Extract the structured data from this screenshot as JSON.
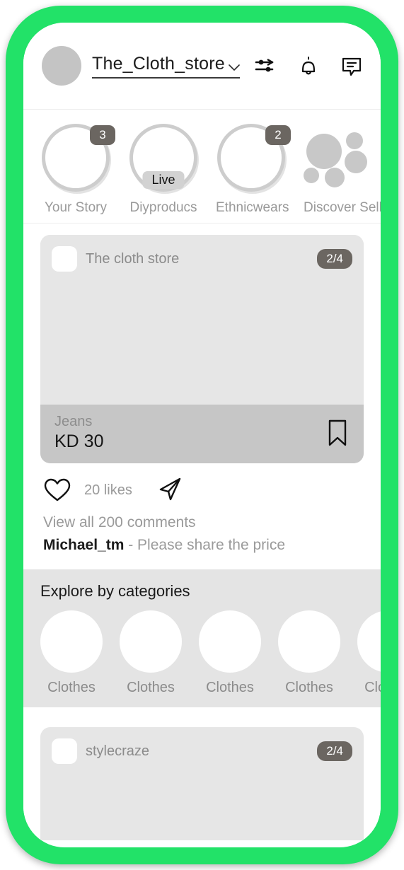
{
  "theme": {
    "frame_color": "#22e268",
    "screen_background": "#ffffff",
    "badge_color": "#6b6661"
  },
  "header": {
    "avatar": "profile-avatar",
    "store_name": "The_Cloth_store",
    "dropdown_icon": "chevron-down-icon",
    "icons": [
      {
        "name": "filter-sliders-icon",
        "label": "Filters"
      },
      {
        "name": "bell-icon",
        "label": "Notifications"
      },
      {
        "name": "message-icon",
        "label": "Messages"
      }
    ]
  },
  "stories": [
    {
      "label": "Your Story",
      "badge": "3",
      "live": false,
      "type": "ring"
    },
    {
      "label": "Diyproducs",
      "badge": "",
      "live": true,
      "live_label": "Live",
      "type": "ring"
    },
    {
      "label": "Ethnicwears",
      "badge": "2",
      "live": false,
      "type": "ring"
    },
    {
      "label": "Discover Sellers",
      "badge": "",
      "live": false,
      "type": "bubbles"
    }
  ],
  "posts": [
    {
      "user": "The cloth store",
      "count": "2/4",
      "product_name": "Jeans",
      "product_price": "KD 30",
      "save_icon": "bookmark-icon",
      "like_icon": "heart-icon",
      "likes": "20 likes",
      "share_icon": "share-icon",
      "view_comments": "View all 200 comments",
      "comment_user": "Michael_tm",
      "comment_text": "- Please share the price"
    },
    {
      "user": "stylecraze",
      "count": "2/4"
    }
  ],
  "explore": {
    "title": "Explore by categories",
    "categories": [
      {
        "label": "Clothes"
      },
      {
        "label": "Clothes"
      },
      {
        "label": "Clothes"
      },
      {
        "label": "Clothes"
      },
      {
        "label": "Clothes"
      }
    ]
  }
}
